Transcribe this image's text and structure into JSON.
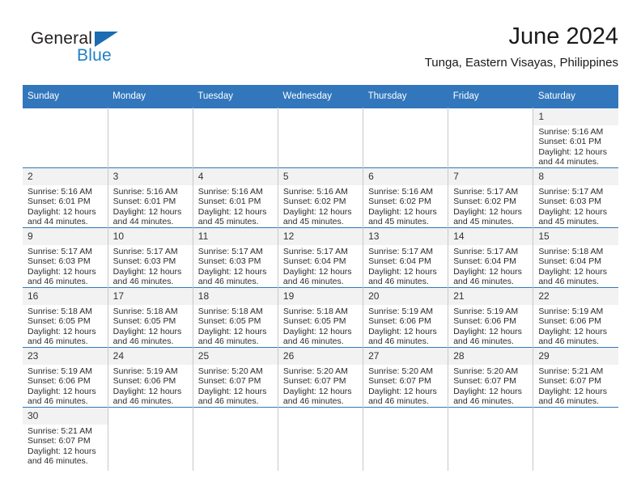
{
  "brand": {
    "name_top": "General",
    "name_bottom": "Blue",
    "triangle_color": "#1b6cb0",
    "blue_text_color": "#1f7fc4"
  },
  "header": {
    "month_title": "June 2024",
    "location": "Tunga, Eastern Visayas, Philippines"
  },
  "theme": {
    "header_blue": "#3277bc",
    "date_band_gray": "#f2f2f2",
    "cell_divider_gray": "#c8c8c8"
  },
  "calendar": {
    "weekday_headers": [
      "Sunday",
      "Monday",
      "Tuesday",
      "Wednesday",
      "Thursday",
      "Friday",
      "Saturday"
    ],
    "weeks": [
      [
        {
          "date": "",
          "sunrise": "",
          "sunset": "",
          "daylight_line1": "",
          "daylight_line2": "",
          "empty": true
        },
        {
          "date": "",
          "sunrise": "",
          "sunset": "",
          "daylight_line1": "",
          "daylight_line2": "",
          "empty": true
        },
        {
          "date": "",
          "sunrise": "",
          "sunset": "",
          "daylight_line1": "",
          "daylight_line2": "",
          "empty": true
        },
        {
          "date": "",
          "sunrise": "",
          "sunset": "",
          "daylight_line1": "",
          "daylight_line2": "",
          "empty": true
        },
        {
          "date": "",
          "sunrise": "",
          "sunset": "",
          "daylight_line1": "",
          "daylight_line2": "",
          "empty": true
        },
        {
          "date": "",
          "sunrise": "",
          "sunset": "",
          "daylight_line1": "",
          "daylight_line2": "",
          "empty": true
        },
        {
          "date": "1",
          "sunrise": "Sunrise: 5:16 AM",
          "sunset": "Sunset: 6:01 PM",
          "daylight_line1": "Daylight: 12 hours",
          "daylight_line2": "and 44 minutes.",
          "empty": false
        }
      ],
      [
        {
          "date": "2",
          "sunrise": "Sunrise: 5:16 AM",
          "sunset": "Sunset: 6:01 PM",
          "daylight_line1": "Daylight: 12 hours",
          "daylight_line2": "and 44 minutes.",
          "empty": false
        },
        {
          "date": "3",
          "sunrise": "Sunrise: 5:16 AM",
          "sunset": "Sunset: 6:01 PM",
          "daylight_line1": "Daylight: 12 hours",
          "daylight_line2": "and 44 minutes.",
          "empty": false
        },
        {
          "date": "4",
          "sunrise": "Sunrise: 5:16 AM",
          "sunset": "Sunset: 6:01 PM",
          "daylight_line1": "Daylight: 12 hours",
          "daylight_line2": "and 45 minutes.",
          "empty": false
        },
        {
          "date": "5",
          "sunrise": "Sunrise: 5:16 AM",
          "sunset": "Sunset: 6:02 PM",
          "daylight_line1": "Daylight: 12 hours",
          "daylight_line2": "and 45 minutes.",
          "empty": false
        },
        {
          "date": "6",
          "sunrise": "Sunrise: 5:16 AM",
          "sunset": "Sunset: 6:02 PM",
          "daylight_line1": "Daylight: 12 hours",
          "daylight_line2": "and 45 minutes.",
          "empty": false
        },
        {
          "date": "7",
          "sunrise": "Sunrise: 5:17 AM",
          "sunset": "Sunset: 6:02 PM",
          "daylight_line1": "Daylight: 12 hours",
          "daylight_line2": "and 45 minutes.",
          "empty": false
        },
        {
          "date": "8",
          "sunrise": "Sunrise: 5:17 AM",
          "sunset": "Sunset: 6:03 PM",
          "daylight_line1": "Daylight: 12 hours",
          "daylight_line2": "and 45 minutes.",
          "empty": false
        }
      ],
      [
        {
          "date": "9",
          "sunrise": "Sunrise: 5:17 AM",
          "sunset": "Sunset: 6:03 PM",
          "daylight_line1": "Daylight: 12 hours",
          "daylight_line2": "and 46 minutes.",
          "empty": false
        },
        {
          "date": "10",
          "sunrise": "Sunrise: 5:17 AM",
          "sunset": "Sunset: 6:03 PM",
          "daylight_line1": "Daylight: 12 hours",
          "daylight_line2": "and 46 minutes.",
          "empty": false
        },
        {
          "date": "11",
          "sunrise": "Sunrise: 5:17 AM",
          "sunset": "Sunset: 6:03 PM",
          "daylight_line1": "Daylight: 12 hours",
          "daylight_line2": "and 46 minutes.",
          "empty": false
        },
        {
          "date": "12",
          "sunrise": "Sunrise: 5:17 AM",
          "sunset": "Sunset: 6:04 PM",
          "daylight_line1": "Daylight: 12 hours",
          "daylight_line2": "and 46 minutes.",
          "empty": false
        },
        {
          "date": "13",
          "sunrise": "Sunrise: 5:17 AM",
          "sunset": "Sunset: 6:04 PM",
          "daylight_line1": "Daylight: 12 hours",
          "daylight_line2": "and 46 minutes.",
          "empty": false
        },
        {
          "date": "14",
          "sunrise": "Sunrise: 5:17 AM",
          "sunset": "Sunset: 6:04 PM",
          "daylight_line1": "Daylight: 12 hours",
          "daylight_line2": "and 46 minutes.",
          "empty": false
        },
        {
          "date": "15",
          "sunrise": "Sunrise: 5:18 AM",
          "sunset": "Sunset: 6:04 PM",
          "daylight_line1": "Daylight: 12 hours",
          "daylight_line2": "and 46 minutes.",
          "empty": false
        }
      ],
      [
        {
          "date": "16",
          "sunrise": "Sunrise: 5:18 AM",
          "sunset": "Sunset: 6:05 PM",
          "daylight_line1": "Daylight: 12 hours",
          "daylight_line2": "and 46 minutes.",
          "empty": false
        },
        {
          "date": "17",
          "sunrise": "Sunrise: 5:18 AM",
          "sunset": "Sunset: 6:05 PM",
          "daylight_line1": "Daylight: 12 hours",
          "daylight_line2": "and 46 minutes.",
          "empty": false
        },
        {
          "date": "18",
          "sunrise": "Sunrise: 5:18 AM",
          "sunset": "Sunset: 6:05 PM",
          "daylight_line1": "Daylight: 12 hours",
          "daylight_line2": "and 46 minutes.",
          "empty": false
        },
        {
          "date": "19",
          "sunrise": "Sunrise: 5:18 AM",
          "sunset": "Sunset: 6:05 PM",
          "daylight_line1": "Daylight: 12 hours",
          "daylight_line2": "and 46 minutes.",
          "empty": false
        },
        {
          "date": "20",
          "sunrise": "Sunrise: 5:19 AM",
          "sunset": "Sunset: 6:06 PM",
          "daylight_line1": "Daylight: 12 hours",
          "daylight_line2": "and 46 minutes.",
          "empty": false
        },
        {
          "date": "21",
          "sunrise": "Sunrise: 5:19 AM",
          "sunset": "Sunset: 6:06 PM",
          "daylight_line1": "Daylight: 12 hours",
          "daylight_line2": "and 46 minutes.",
          "empty": false
        },
        {
          "date": "22",
          "sunrise": "Sunrise: 5:19 AM",
          "sunset": "Sunset: 6:06 PM",
          "daylight_line1": "Daylight: 12 hours",
          "daylight_line2": "and 46 minutes.",
          "empty": false
        }
      ],
      [
        {
          "date": "23",
          "sunrise": "Sunrise: 5:19 AM",
          "sunset": "Sunset: 6:06 PM",
          "daylight_line1": "Daylight: 12 hours",
          "daylight_line2": "and 46 minutes.",
          "empty": false
        },
        {
          "date": "24",
          "sunrise": "Sunrise: 5:19 AM",
          "sunset": "Sunset: 6:06 PM",
          "daylight_line1": "Daylight: 12 hours",
          "daylight_line2": "and 46 minutes.",
          "empty": false
        },
        {
          "date": "25",
          "sunrise": "Sunrise: 5:20 AM",
          "sunset": "Sunset: 6:07 PM",
          "daylight_line1": "Daylight: 12 hours",
          "daylight_line2": "and 46 minutes.",
          "empty": false
        },
        {
          "date": "26",
          "sunrise": "Sunrise: 5:20 AM",
          "sunset": "Sunset: 6:07 PM",
          "daylight_line1": "Daylight: 12 hours",
          "daylight_line2": "and 46 minutes.",
          "empty": false
        },
        {
          "date": "27",
          "sunrise": "Sunrise: 5:20 AM",
          "sunset": "Sunset: 6:07 PM",
          "daylight_line1": "Daylight: 12 hours",
          "daylight_line2": "and 46 minutes.",
          "empty": false
        },
        {
          "date": "28",
          "sunrise": "Sunrise: 5:20 AM",
          "sunset": "Sunset: 6:07 PM",
          "daylight_line1": "Daylight: 12 hours",
          "daylight_line2": "and 46 minutes.",
          "empty": false
        },
        {
          "date": "29",
          "sunrise": "Sunrise: 5:21 AM",
          "sunset": "Sunset: 6:07 PM",
          "daylight_line1": "Daylight: 12 hours",
          "daylight_line2": "and 46 minutes.",
          "empty": false
        }
      ],
      [
        {
          "date": "30",
          "sunrise": "Sunrise: 5:21 AM",
          "sunset": "Sunset: 6:07 PM",
          "daylight_line1": "Daylight: 12 hours",
          "daylight_line2": "and 46 minutes.",
          "empty": false
        },
        {
          "date": "",
          "sunrise": "",
          "sunset": "",
          "daylight_line1": "",
          "daylight_line2": "",
          "empty": true
        },
        {
          "date": "",
          "sunrise": "",
          "sunset": "",
          "daylight_line1": "",
          "daylight_line2": "",
          "empty": true
        },
        {
          "date": "",
          "sunrise": "",
          "sunset": "",
          "daylight_line1": "",
          "daylight_line2": "",
          "empty": true
        },
        {
          "date": "",
          "sunrise": "",
          "sunset": "",
          "daylight_line1": "",
          "daylight_line2": "",
          "empty": true
        },
        {
          "date": "",
          "sunrise": "",
          "sunset": "",
          "daylight_line1": "",
          "daylight_line2": "",
          "empty": true
        },
        {
          "date": "",
          "sunrise": "",
          "sunset": "",
          "daylight_line1": "",
          "daylight_line2": "",
          "empty": true
        }
      ]
    ]
  }
}
